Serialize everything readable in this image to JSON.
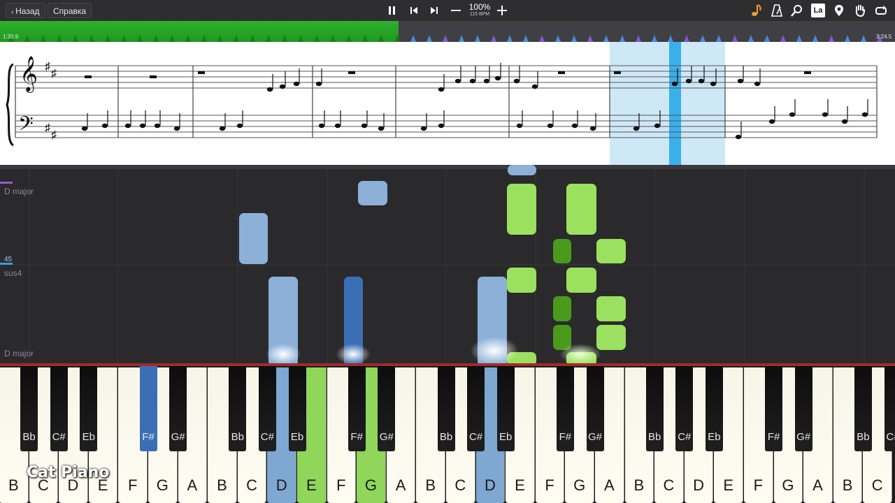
{
  "toolbar": {
    "back_label": "Назад",
    "help_label": "Справка",
    "zoom": "100%",
    "bpm": "115 BPM",
    "icons": [
      "pause-icon",
      "skip-back-icon",
      "skip-forward-icon",
      "minus-icon",
      "plus-icon",
      "note-icon",
      "metronome-icon",
      "search-icon",
      "la-icon",
      "pin-icon",
      "hand-icon",
      "loop-icon"
    ],
    "la_label": "La"
  },
  "timeline": {
    "start_time": "1:30.9",
    "end_time": "3:24.5",
    "progress": 0.445,
    "progress_color": "#2fae2f"
  },
  "roll": {
    "labels": [
      "D major",
      "45",
      "sus4",
      "D major"
    ]
  },
  "keyboard": {
    "white_keys": [
      "B",
      "C",
      "D",
      "E",
      "F",
      "G",
      "A",
      "B",
      "C",
      "D",
      "E",
      "F",
      "G",
      "A",
      "B",
      "C",
      "D",
      "E",
      "F",
      "G",
      "A",
      "B",
      "C",
      "D",
      "E",
      "F",
      "G",
      "A",
      "B",
      "C"
    ],
    "black_keys": [
      "Bb",
      "C#",
      "Eb",
      "F#",
      "G#",
      "Bb",
      "C#",
      "Eb",
      "F#",
      "G#",
      "Bb",
      "C#",
      "Eb",
      "F#",
      "G#",
      "Bb",
      "C#",
      "Eb",
      "F#",
      "G#",
      "Bb",
      "C#"
    ],
    "pressed_colors": {
      "left": "#7ea7d2",
      "right": "#8fd65a"
    }
  },
  "watermark": "Cat Piano",
  "colors": {
    "left_hand": "#8cb0d8",
    "left_hand_dark": "#3a6fb5",
    "right_hand": "#9be05e",
    "right_hand_dark": "#4a9a1c",
    "highlight": "#cfe8f7"
  }
}
